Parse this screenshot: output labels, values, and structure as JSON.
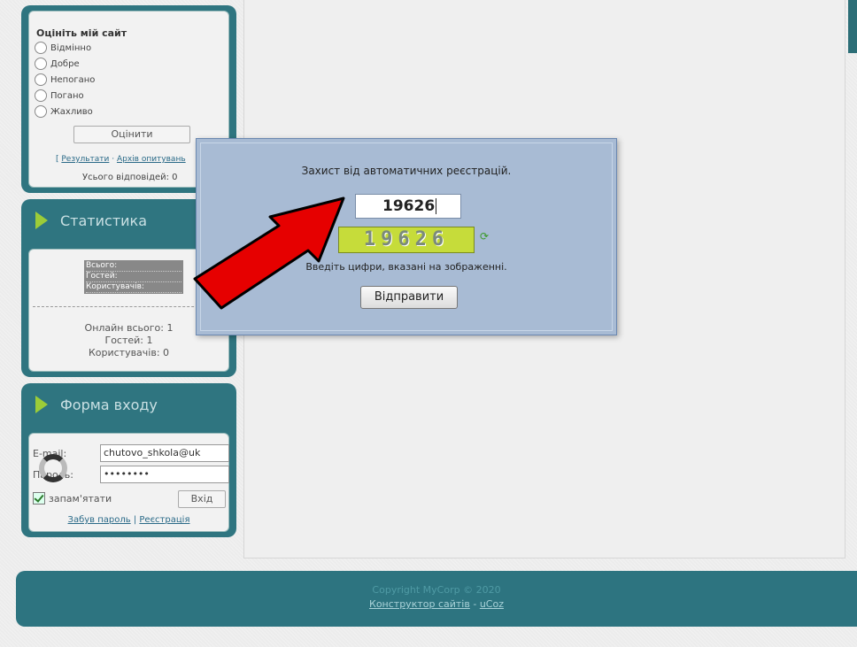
{
  "poll": {
    "title": "Оцініть мій сайт",
    "options": [
      "Відмінно",
      "Добре",
      "Непогано",
      "Погано",
      "Жахливо"
    ],
    "submit_label": "Оцінити",
    "results_link": "Результати",
    "archive_link": "Архів опитувань",
    "total_label": "Усього відповідей: 0"
  },
  "stats": {
    "header": "Статистика",
    "select_items": [
      "Всього:",
      "Гостей:",
      "Користувачів:"
    ],
    "online_total": "Онлайн всього: 1",
    "guests": "Гостей: 1",
    "users": "Користувачів: 0"
  },
  "login": {
    "header": "Форма входу",
    "email_label": "E-mail:",
    "email_value": "chutovo_shkola@uk",
    "password_label": "Пароль:",
    "password_value": "••••••••",
    "remember_label": "запам'ятати",
    "login_button": "Вхід",
    "forgot_link": "Забув пароль",
    "register_link": "Реєстрація"
  },
  "footer": {
    "copyright": "Copyright MyCorp © 2020",
    "builder_link": "Конструктор сайтів",
    "ucoz_link": "uCoz"
  },
  "modal": {
    "title": "Захист від автоматичних реєстрацій.",
    "input_value": "19626",
    "captcha_text": "19626",
    "hint": "Введіть цифри, вказані на зображенні.",
    "submit_label": "Відправити"
  },
  "colors": {
    "panel": "#2f7580",
    "accent_chevron": "#9ccc38",
    "arrow": "#e60000",
    "modal_bg": "#a8bbd4"
  }
}
